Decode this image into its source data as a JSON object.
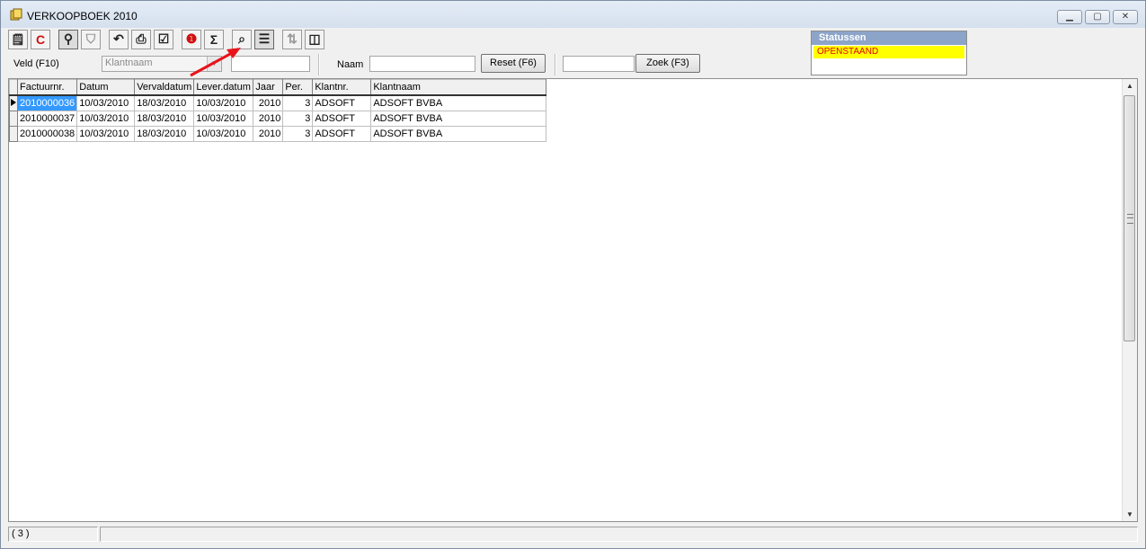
{
  "window": {
    "title": "VERKOOPBOEK 2010",
    "controls": {
      "minimize": "▁",
      "maximize": "▢",
      "close": "✕"
    }
  },
  "toolbar": {
    "buttons": [
      {
        "name": "properties-icon",
        "glyph": "🗒"
      },
      {
        "name": "refresh-red-icon",
        "glyph": "C"
      },
      {
        "name": "binoculars-icon",
        "glyph": "⚲"
      },
      {
        "name": "filter-icon",
        "glyph": "⛉"
      },
      {
        "name": "undo-icon",
        "glyph": "↶"
      },
      {
        "name": "print-icon",
        "glyph": "⎙"
      },
      {
        "name": "checkbox-icon",
        "glyph": "☑"
      },
      {
        "name": "info-icon",
        "glyph": "❶"
      },
      {
        "name": "sum-icon",
        "glyph": "Σ"
      },
      {
        "name": "search-glass-icon",
        "glyph": "⌕"
      },
      {
        "name": "list-icon",
        "glyph": "☰"
      },
      {
        "name": "sort-az-icon",
        "glyph": "⇅"
      },
      {
        "name": "columns-icon",
        "glyph": "◫"
      }
    ]
  },
  "statuspanel": {
    "header": "Statussen",
    "items": [
      "OPENSTAAND"
    ]
  },
  "filter": {
    "veld_label": "Veld (F10)",
    "veld_value": "Klantnaam",
    "naam_label": "Naam",
    "naam_value": "",
    "reset_label": "Reset (F6)",
    "zoek_value": "",
    "zoek_label": "Zoek (F3)"
  },
  "grid": {
    "columns": [
      "Factuurnr.",
      "Datum",
      "Vervaldatum",
      "Lever.datum",
      "Jaar",
      "Per.",
      "Klantnr.",
      "Klantnaam"
    ],
    "rows": [
      [
        "2010000036",
        "10/03/2010",
        "18/03/2010",
        "10/03/2010",
        "2010",
        "3",
        "ADSOFT",
        "ADSOFT BVBA"
      ],
      [
        "2010000037",
        "10/03/2010",
        "18/03/2010",
        "10/03/2010",
        "2010",
        "3",
        "ADSOFT",
        "ADSOFT BVBA"
      ],
      [
        "2010000038",
        "10/03/2010",
        "18/03/2010",
        "10/03/2010",
        "2010",
        "3",
        "ADSOFT",
        "ADSOFT BVBA"
      ]
    ]
  },
  "statusbar": {
    "count": "( 3 )"
  },
  "colors": {
    "selection": "#3399ff",
    "status_item_bg": "#ffff00",
    "status_item_text": "#e00000",
    "status_header": "#8da4c9",
    "annotation_arrow": "#e8141a"
  }
}
